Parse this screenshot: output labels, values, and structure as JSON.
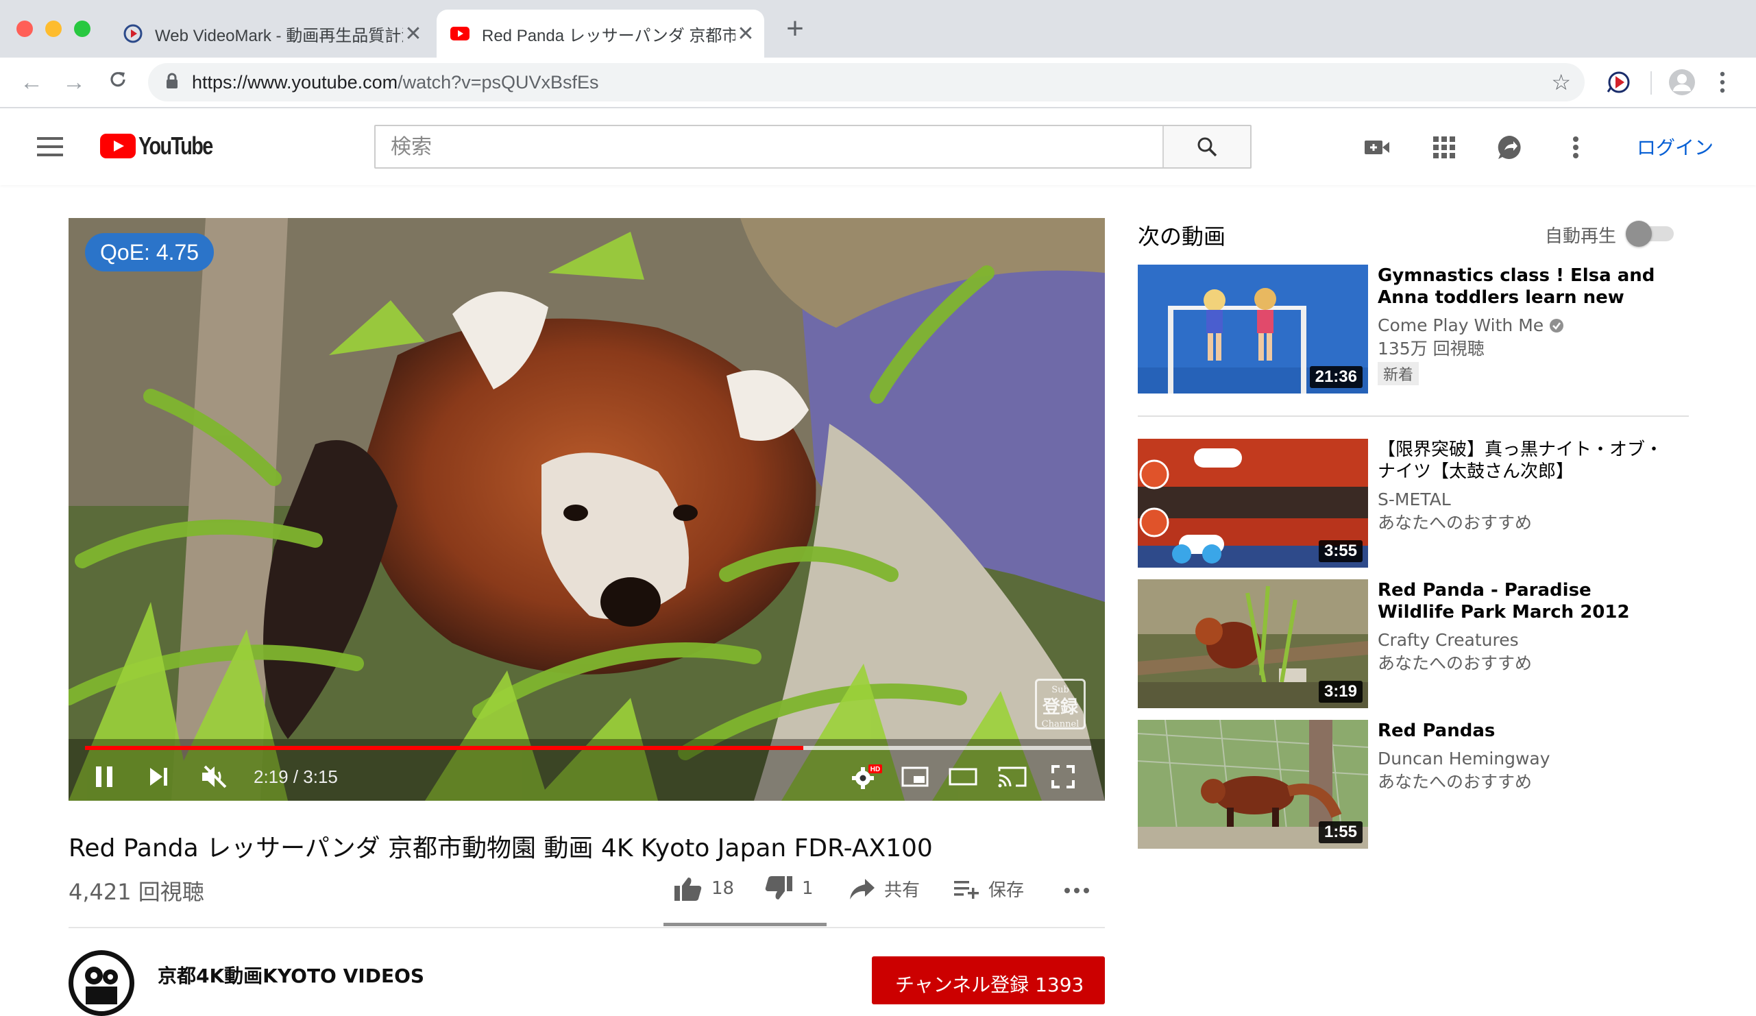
{
  "browser": {
    "tabs": [
      {
        "title": "Web VideoMark - 動画再生品質計測",
        "active": false
      },
      {
        "title": "Red Panda レッサーパンダ 京都市動物園",
        "active": true
      }
    ],
    "url_host": "https://www.youtube.com",
    "url_path": "/watch?v=psQUVxBsfEs"
  },
  "youtube": {
    "logo_text": "YouTube",
    "search_placeholder": "検索",
    "login_label": "ログイン"
  },
  "player": {
    "qoe_label": "QoE: 4.75",
    "watermark_top": "Sub",
    "watermark_mid": "登録",
    "watermark_bottom": "Channel",
    "time_display": "2:19 / 3:15",
    "progress_played_fraction": 0.714,
    "progress_buffered_fraction": 1.0
  },
  "video": {
    "title": "Red Panda レッサーパンダ 京都市動物園 動画 4K Kyoto Japan FDR-AX100",
    "views": "4,421 回視聴",
    "likes": "18",
    "dislikes": "1",
    "share_label": "共有",
    "save_label": "保存",
    "channel_name": "京都4K動画KYOTO VIDEOS",
    "subscribe_label": "チャンネル登録",
    "subscriber_count": "1393"
  },
  "sidebar": {
    "up_next_label": "次の動画",
    "autoplay_label": "自動再生",
    "autoplay_on": false,
    "items": [
      {
        "title": "Gymnastics class ! Elsa and Anna toddlers learn new tricks...",
        "channel": "Come Play With Me",
        "verified": true,
        "views": "135万 回視聴",
        "badge": "新着",
        "duration": "21:36"
      },
      {
        "title": "【限界突破】真っ黒ナイト・オブ・ナイツ【太鼓さん次郎】",
        "channel": "S-METAL",
        "views": "あなたへのおすすめ",
        "duration": "3:55"
      },
      {
        "title": "Red Panda - Paradise Wildlife Park March 2012",
        "channel": "Crafty Creatures",
        "views": "あなたへのおすすめ",
        "duration": "3:19"
      },
      {
        "title": "Red Pandas",
        "channel": "Duncan Hemingway",
        "views": "あなたへのおすすめ",
        "duration": "1:55"
      }
    ]
  },
  "colors": {
    "youtube_red": "#ff0000",
    "qoe_badge": "#2b74c9",
    "link_blue": "#065fd4",
    "subscribe_red": "#cc0000"
  }
}
